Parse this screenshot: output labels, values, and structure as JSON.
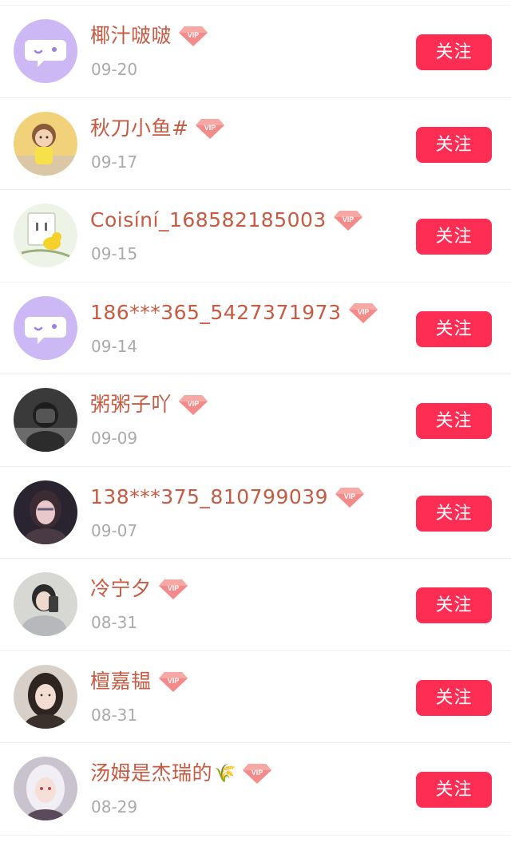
{
  "colors": {
    "name": "#c65a42",
    "date": "#aaaaaa",
    "follow_button": "#fd2d54",
    "vip_badge": "#e84e5c",
    "default_avatar": "#c9b6f5"
  },
  "vip_label": "VIP",
  "items": [
    {
      "name": "椰汁啵啵",
      "date": "09-20",
      "follow_label": "关注",
      "avatar": "default-chat-avatar"
    },
    {
      "name": "秋刀小鱼#",
      "date": "09-17",
      "follow_label": "关注",
      "avatar": "doll-photo-avatar"
    },
    {
      "name": "Coisíní_168582185003",
      "date": "09-15",
      "follow_label": "关注",
      "avatar": "duck-plug-avatar"
    },
    {
      "name": "186***365_5427371973",
      "date": "09-14",
      "follow_label": "关注",
      "avatar": "default-chat-avatar"
    },
    {
      "name": "粥粥子吖",
      "date": "09-09",
      "follow_label": "关注",
      "avatar": "person-photo-avatar"
    },
    {
      "name": "138***375_810799039",
      "date": "09-07",
      "follow_label": "关注",
      "avatar": "girl-photo-avatar"
    },
    {
      "name": "冷宁夕",
      "date": "08-31",
      "follow_label": "关注",
      "avatar": "mirror-selfie-avatar"
    },
    {
      "name": "檀嘉韫",
      "date": "08-31",
      "follow_label": "关注",
      "avatar": "girl-portrait-avatar"
    },
    {
      "name": "汤姆是杰瑞的",
      "name_emoji": "🌾",
      "date": "08-29",
      "follow_label": "关注",
      "avatar": "anime-girl-avatar"
    }
  ]
}
